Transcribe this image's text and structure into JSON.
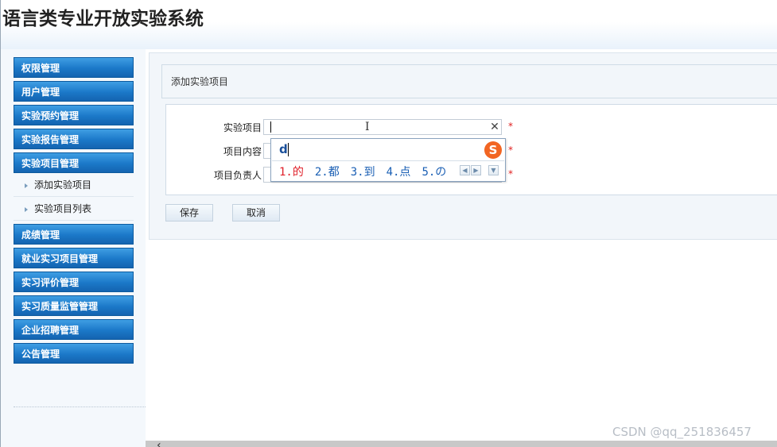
{
  "app": {
    "title": "语言类专业开放实验系统"
  },
  "sidebar": {
    "groups": [
      {
        "label": "权限管理"
      },
      {
        "label": "用户管理"
      },
      {
        "label": "实验预约管理"
      },
      {
        "label": "实验报告管理"
      },
      {
        "label": "实验项目管理",
        "expanded": true,
        "children": [
          {
            "label": "添加实验项目"
          },
          {
            "label": "实验项目列表"
          }
        ]
      },
      {
        "label": "成绩管理"
      },
      {
        "label": "就业实习项目管理"
      },
      {
        "label": "实习评价管理"
      },
      {
        "label": "实习质量监管管理"
      },
      {
        "label": "企业招聘管理"
      },
      {
        "label": "公告管理"
      }
    ]
  },
  "main": {
    "heading": "添加实验项目",
    "form": {
      "fields": [
        {
          "label": "实验项目",
          "value": "",
          "required_mark": "*",
          "clear_glyph": "✕"
        },
        {
          "label": "项目内容",
          "value": "",
          "required_mark": "*"
        },
        {
          "label": "项目负责人",
          "value": "",
          "required_mark": "*"
        }
      ],
      "save_label": "保存",
      "cancel_label": "取消"
    }
  },
  "ime": {
    "input": "d",
    "logo": "S",
    "candidates": [
      "1.的",
      "2.都",
      "3.到",
      "4.点",
      "5.の"
    ],
    "nav_prev": "◀",
    "nav_next": "▶",
    "nav_more": "▼"
  },
  "watermark": "CSDN @qq_251836457",
  "colors": {
    "menu_blue": "#1b78c8",
    "required_red": "#e02020",
    "ime_logo": "#f26522",
    "candidate_first": "#e0202a",
    "candidate_other": "#1a5fb4"
  }
}
